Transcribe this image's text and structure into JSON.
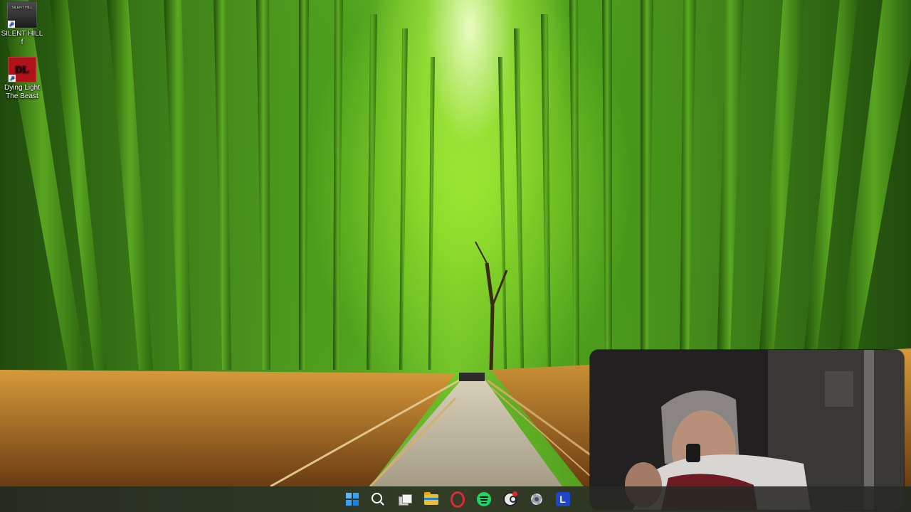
{
  "desktop": {
    "icons": [
      {
        "label": "SILENT HILL f",
        "thumb_text": "SILENT HILL",
        "icon": "silent-hill-f-icon"
      },
      {
        "label": "Dying Light The Beast",
        "thumb_text": "DL",
        "icon": "dying-light-icon"
      }
    ]
  },
  "taskbar": {
    "items": [
      {
        "name": "start",
        "icon": "windows-logo-icon"
      },
      {
        "name": "search",
        "icon": "search-icon"
      },
      {
        "name": "task-view",
        "icon": "task-view-icon"
      },
      {
        "name": "file-explorer",
        "icon": "folder-icon"
      },
      {
        "name": "opera",
        "icon": "opera-icon"
      },
      {
        "name": "spotify",
        "icon": "spotify-icon"
      },
      {
        "name": "steam",
        "icon": "steam-icon"
      },
      {
        "name": "settings",
        "icon": "gear-icon"
      },
      {
        "name": "app-l",
        "icon": "l-app-icon",
        "letter": "L"
      }
    ]
  },
  "colors": {
    "taskbar": "#282824",
    "bamboo": "#4f9e1e",
    "grass": "#b9762a"
  }
}
